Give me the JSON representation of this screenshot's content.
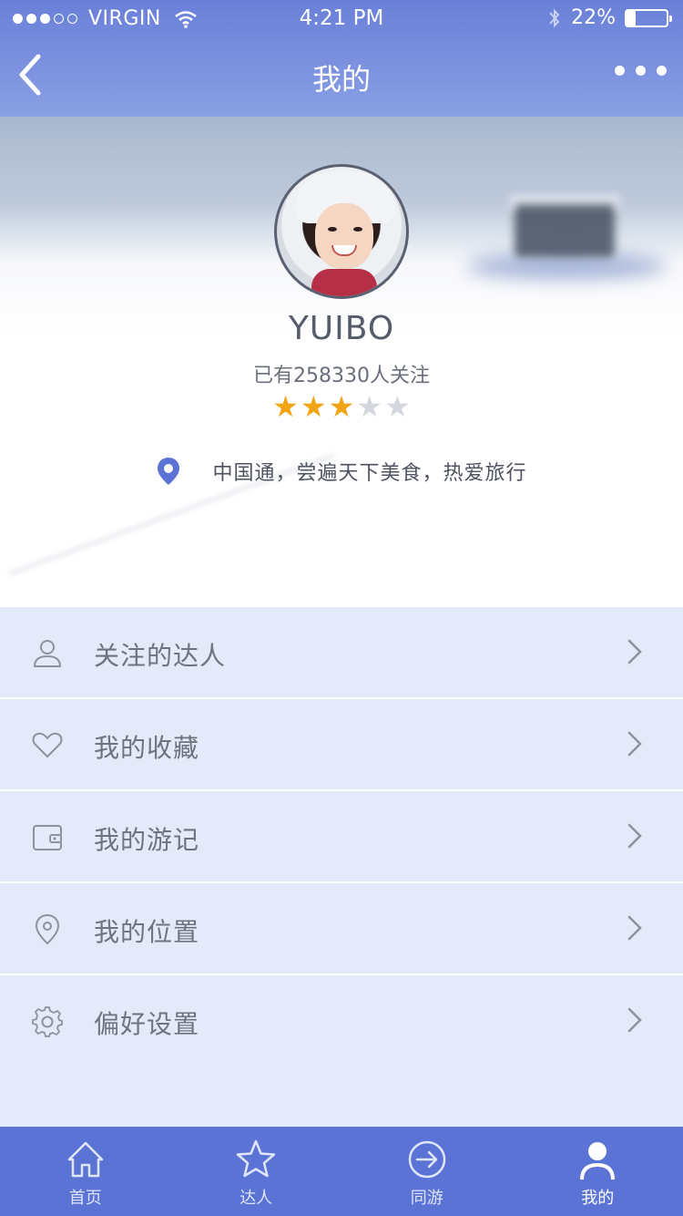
{
  "status_bar": {
    "carrier": "VIRGIN",
    "time": "4:21 PM",
    "battery": "22%",
    "battery_level": 0.22,
    "signal_bars_filled": 3,
    "signal_bars_total": 5
  },
  "nav": {
    "title": "我的",
    "back_icon": "chevron-left-icon",
    "more_icon": "ellipsis-icon"
  },
  "profile": {
    "username": "YUIBO",
    "followers": "已有258330人关注",
    "rating": 3,
    "rating_max": 5,
    "bio": "中国通，尝遍天下美食，热爱旅行",
    "bio_icon": "location-pin-icon"
  },
  "menu": {
    "items": [
      {
        "label": "关注的达人",
        "icon": "person-icon"
      },
      {
        "label": "我的收藏",
        "icon": "heart-icon"
      },
      {
        "label": "我的游记",
        "icon": "wallet-icon"
      },
      {
        "label": "我的位置",
        "icon": "location-pin-icon"
      },
      {
        "label": "偏好设置",
        "icon": "gear-icon"
      }
    ]
  },
  "tabbar": {
    "tabs": [
      {
        "label": "首页",
        "icon": "home-icon",
        "active": false
      },
      {
        "label": "达人",
        "icon": "star-icon",
        "active": false
      },
      {
        "label": "同游",
        "icon": "arrow-circle-icon",
        "active": false
      },
      {
        "label": "我的",
        "icon": "user-icon",
        "active": true
      }
    ]
  },
  "colors": {
    "header": "#7b91df",
    "tabbar": "#5b73d4",
    "menu_bg": "#e4eaf9",
    "star_on": "#f1a514",
    "star_off": "#d4d7de",
    "pin": "#5b73d4"
  }
}
